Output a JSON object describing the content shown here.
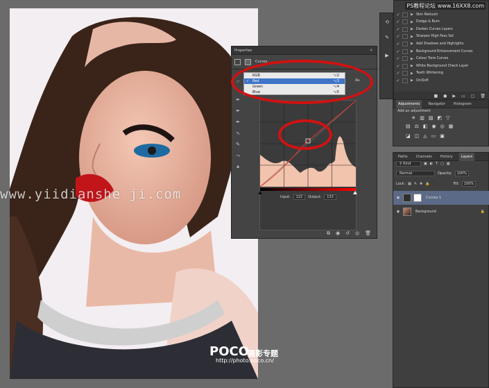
{
  "site_watermark_top": "PS教程论坛  www.16XX8.com",
  "watermark_mid": "www.yiidianshe ji.com",
  "watermark_poco": "POCO",
  "watermark_poco_cn": "摄影专题",
  "watermark_url": "http://photo.poco.cn/",
  "actions": {
    "items": [
      "Skin Retouch",
      "Dodge & Burn",
      "Darken Curves Layers",
      "Sharpen High Pass Set",
      "Add Shadows and Highlights",
      "Background Enhancement Curves",
      "Colour Tone Curves",
      "White Background Check Layer",
      "Teeth Whitening",
      "On/Soft"
    ]
  },
  "properties": {
    "title": "Properties",
    "subtitle": "Curves",
    "channel_menu": [
      {
        "label": "RGB",
        "shortcut": "⌥2"
      },
      {
        "label": "Red",
        "shortcut": "⌥3"
      },
      {
        "label": "Green",
        "shortcut": "⌥4"
      },
      {
        "label": "Blue",
        "shortcut": "⌥5"
      }
    ],
    "auto_label": "Au",
    "input_label": "Input:",
    "input_value": "122",
    "output_label": "Output:",
    "output_value": "133"
  },
  "adjustments": {
    "tabs": [
      "Adjustments",
      "Navigator",
      "Histogram"
    ],
    "add_label": "Add an adjustment"
  },
  "layers": {
    "tabs": [
      "Paths",
      "Channels",
      "History",
      "Layers"
    ],
    "kind_label": "Kind",
    "blend_mode": "Normal",
    "opacity_label": "Opacity:",
    "opacity_value": "100%",
    "lock_label": "Lock:",
    "fill_label": "Fill:",
    "fill_value": "100%",
    "rows": [
      {
        "name": "Curves 1"
      },
      {
        "name": "Background"
      }
    ]
  },
  "colors": {
    "accent": "#d01212",
    "panel": "#424242",
    "selection": "#3f74c8"
  }
}
